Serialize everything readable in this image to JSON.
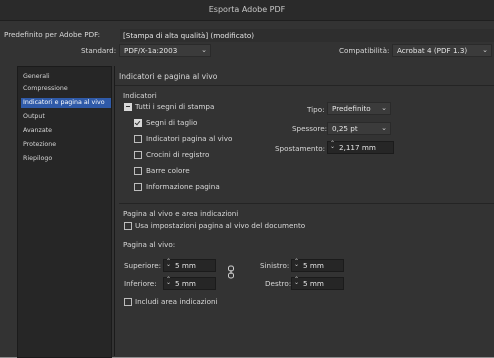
{
  "window": {
    "title": "Esporta Adobe PDF",
    "preset_label": "Predefinito per Adobe PDF:",
    "preset_value": "[Stampa di alta qualità] (modificato)",
    "standard_label": "Standard:",
    "standard_value": "PDF/X-1a:2003",
    "compat_label": "Compatibilità:",
    "compat_value": "Acrobat 4 (PDF 1.3)"
  },
  "sidebar": {
    "items": [
      {
        "label": "Generali",
        "selected": false
      },
      {
        "label": "Compressione",
        "selected": false
      },
      {
        "label": "Indicatori e pagina al vivo",
        "selected": true
      },
      {
        "label": "Output",
        "selected": false
      },
      {
        "label": "Avanzate",
        "selected": false
      },
      {
        "label": "Protezione",
        "selected": false
      },
      {
        "label": "Riepilogo",
        "selected": false
      }
    ]
  },
  "main": {
    "section_title": "Indicatori e pagina al vivo",
    "indicators_group": "Indicatori",
    "all_marks_label": "Tutti i segni di stampa",
    "marks": [
      {
        "label": "Segni di taglio",
        "checked": true
      },
      {
        "label": "Indicatori pagina al vivo",
        "checked": false
      },
      {
        "label": "Crocini di registro",
        "checked": false
      },
      {
        "label": "Barre colore",
        "checked": false
      },
      {
        "label": "Informazione pagina",
        "checked": false
      }
    ],
    "tipo_label": "Tipo:",
    "tipo_value": "Predefinito",
    "spessore_label": "Spessore:",
    "spessore_value": "0,25 pt",
    "spostamento_label": "Spostamento:",
    "spostamento_value": "2,117 mm",
    "bleed_group": "Pagina al vivo e area indicazioni",
    "use_doc_bleed_label": "Usa impostazioni pagina al vivo del documento",
    "bleed_sub": "Pagina al vivo:",
    "superiore_label": "Superiore:",
    "superiore_value": "5 mm",
    "inferiore_label": "Inferiore:",
    "inferiore_value": "5 mm",
    "sinistro_label": "Sinistro:",
    "sinistro_value": "5 mm",
    "destro_label": "Destro:",
    "destro_value": "5 mm",
    "slug_label": "Includi area indicazioni"
  }
}
